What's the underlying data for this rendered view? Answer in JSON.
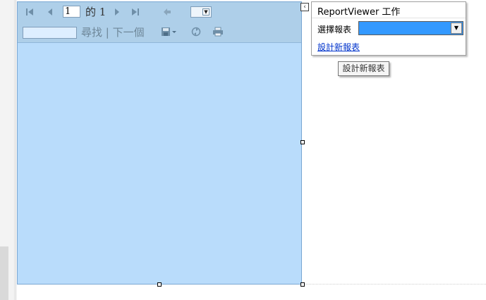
{
  "viewer": {
    "toolbar": {
      "page_current": "1",
      "page_of": "的 1",
      "find_label": "尋找",
      "find_separator": "|",
      "find_next_label": "下一個",
      "icons": [
        "first-page-icon",
        "previous-page-icon",
        "next-page-icon",
        "last-page-icon",
        "back-icon",
        "export-save-icon",
        "refresh-icon",
        "print-icon"
      ]
    },
    "colors": {
      "body": "#b9dcfb",
      "toolbar": "#aecfe9"
    }
  },
  "smart_tag": {
    "arrow": "‹",
    "title": "ReportViewer 工作",
    "choose_report_label": "選擇報表",
    "selected_report": "",
    "design_link": "設計新報表",
    "select_color": "#3399ff"
  },
  "tooltip": {
    "text": "設計新報表"
  }
}
